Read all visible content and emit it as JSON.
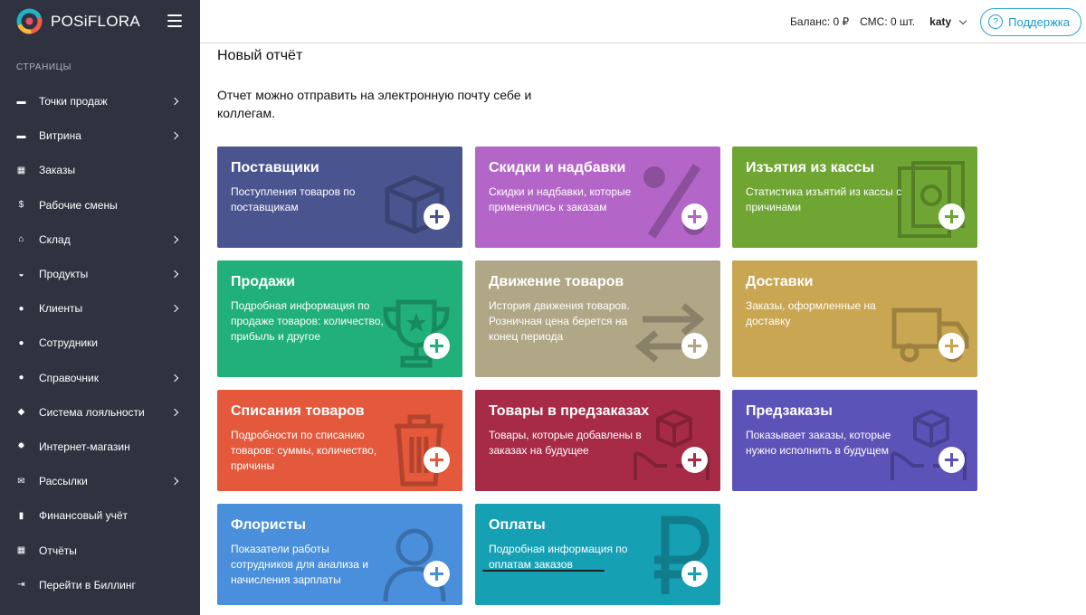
{
  "app": {
    "logo_text": "POSiFLORA",
    "colors": {
      "sidebar": "#2f3340",
      "accent": "#1b9ccf"
    }
  },
  "sidebar": {
    "section_title": "СТРАНИЦЫ",
    "items": [
      {
        "label": "Точки продаж",
        "icon": "store-icon",
        "has_submenu": true
      },
      {
        "label": "Витрина",
        "icon": "showcase-icon",
        "has_submenu": true
      },
      {
        "label": "Заказы",
        "icon": "calendar-icon",
        "has_submenu": false
      },
      {
        "label": "Рабочие смены",
        "icon": "dollar-icon",
        "has_submenu": false
      },
      {
        "label": "Склад",
        "icon": "warehouse-icon",
        "has_submenu": true
      },
      {
        "label": "Продукты",
        "icon": "basket-icon",
        "has_submenu": true
      },
      {
        "label": "Клиенты",
        "icon": "clients-icon",
        "has_submenu": true
      },
      {
        "label": "Сотрудники",
        "icon": "employee-icon",
        "has_submenu": false
      },
      {
        "label": "Справочник",
        "icon": "help-icon",
        "has_submenu": true
      },
      {
        "label": "Система лояльности",
        "icon": "tag-icon",
        "has_submenu": true
      },
      {
        "label": "Интернет-магазин",
        "icon": "gear-icon",
        "has_submenu": false
      },
      {
        "label": "Рассылки",
        "icon": "mail-icon",
        "has_submenu": true
      },
      {
        "label": "Финансовый учёт",
        "icon": "chart-icon",
        "has_submenu": false
      },
      {
        "label": "Отчёты",
        "icon": "reports-icon",
        "has_submenu": false
      },
      {
        "label": "Перейти в Биллинг",
        "icon": "billing-icon",
        "has_submenu": false
      }
    ]
  },
  "header": {
    "balance": "Баланс: 0 ₽",
    "sms": "СМС: 0 шт.",
    "user": "katy",
    "support_label": "Поддержка"
  },
  "page": {
    "title": "Новый отчёт",
    "description": "Отчет можно отправить на электронную почту себе и коллегам."
  },
  "cards": [
    {
      "title": "Поставщики",
      "desc": "Поступления товаров по поставщикам",
      "color": "#4a5590",
      "icon": "box-icon"
    },
    {
      "title": "Скидки и надбавки",
      "desc": "Скидки и надбавки, которые применялись к заказам",
      "color": "#b366c7",
      "icon": "percent-icon"
    },
    {
      "title": "Изъятия из кассы",
      "desc": "Статистика изъятий из кассы с причинами",
      "color": "#6fa532",
      "icon": "cash-icon"
    },
    {
      "title": "Продажи",
      "desc": "Подробная информация по продаже товаров: количество, прибыль и другое",
      "color": "#21b07a",
      "icon": "trophy-icon"
    },
    {
      "title": "Движение товаров",
      "desc": "История движения товаров. Розничная цена берется на конец периода",
      "color": "#b0a786",
      "icon": "arrows-icon"
    },
    {
      "title": "Доставки",
      "desc": "Заказы, оформленные на доставку",
      "color": "#c9a652",
      "icon": "truck-icon"
    },
    {
      "title": "Списания товаров",
      "desc": "Подробности по списанию товаров: суммы, количество, причины",
      "color": "#e4583b",
      "icon": "trash-icon"
    },
    {
      "title": "Товары в предзаказах",
      "desc": "Товары, которые добавлены в заказах на будущее",
      "color": "#a72b46",
      "icon": "hands-box-icon"
    },
    {
      "title": "Предзаказы",
      "desc": "Показывает заказы, которые нужно исполнить в будущем",
      "color": "#5c53b8",
      "icon": "hands-box-icon"
    },
    {
      "title": "Флористы",
      "desc": "Показатели работы сотрудников для анализа и начисления зарплаты",
      "color": "#4a8fdb",
      "icon": "person-icon"
    },
    {
      "title": "Оплаты",
      "desc": "Подробная информация по оплатам заказов",
      "color": "#16a0b4",
      "icon": "ruble-icon"
    }
  ]
}
